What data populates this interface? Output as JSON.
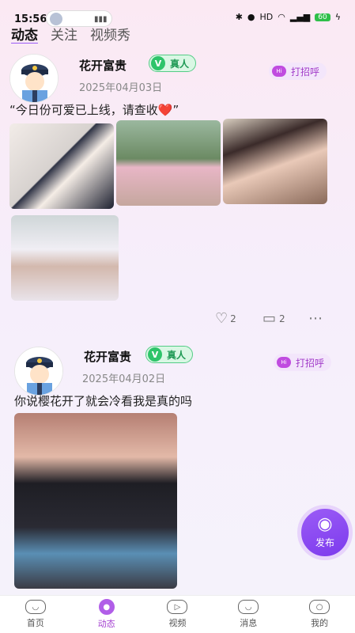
{
  "status": {
    "time": "15:56",
    "battery": "60",
    "net": "HD"
  },
  "topnav": {
    "tabs": [
      {
        "label": "动态"
      },
      {
        "label": "关注"
      },
      {
        "label": "视频秀"
      }
    ]
  },
  "posts": [
    {
      "username": "花开富贵",
      "verified_label": "真人",
      "date": "2025年04月03日",
      "greet_label": "打招呼",
      "greet_badge": "Hi",
      "content": "“今日份可爱已上线，请查收",
      "content_emoji": "❤️",
      "content_tail": "”",
      "likes": "2",
      "comments": "2"
    },
    {
      "username": "花开富贵",
      "verified_label": "真人",
      "date": "2025年04月02日",
      "greet_label": "打招呼",
      "greet_badge": "Hi",
      "content": "你说樱花开了就会冷看我是真的吗"
    }
  ],
  "fab": {
    "label": "发布",
    "icon": "camera-icon"
  },
  "bottomnav": {
    "items": [
      {
        "label": "首页",
        "icon": "home-icon"
      },
      {
        "label": "动态",
        "icon": "feed-icon"
      },
      {
        "label": "视频",
        "icon": "video-icon"
      },
      {
        "label": "消息",
        "icon": "message-icon"
      },
      {
        "label": "我的",
        "icon": "profile-icon"
      }
    ]
  },
  "colors": {
    "accent": "#9b5cf6",
    "verified": "#2ec46a",
    "greet": "#a23cc9",
    "heart": "#e0254a"
  }
}
